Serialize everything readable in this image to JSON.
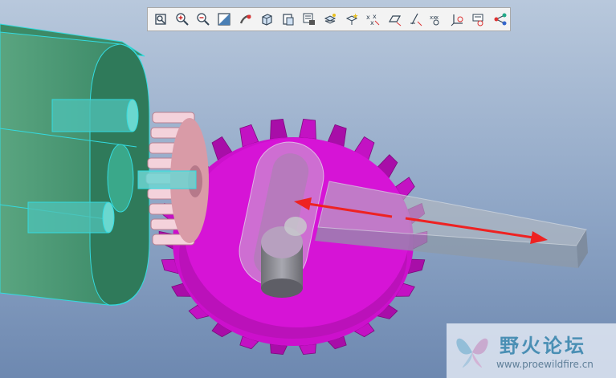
{
  "toolbar": {
    "items": [
      {
        "name": "refit-icon",
        "title": "Refit"
      },
      {
        "name": "zoom-in-icon",
        "title": "Zoom In"
      },
      {
        "name": "zoom-out-icon",
        "title": "Zoom Out"
      },
      {
        "name": "repaint-icon",
        "title": "Repaint"
      },
      {
        "name": "spin-center-icon",
        "title": "Spin Center"
      },
      {
        "name": "display-style-icon",
        "title": "Display Style"
      },
      {
        "name": "saved-views-icon",
        "title": "Saved Orientations"
      },
      {
        "name": "view-manager-icon",
        "title": "View Manager"
      },
      {
        "name": "layers-icon",
        "title": "Layers"
      },
      {
        "name": "appearance-icon",
        "title": "Appearance"
      },
      {
        "name": "datum-points-icon",
        "title": "Datum Points"
      },
      {
        "name": "datum-planes-icon",
        "title": "Datum Planes"
      },
      {
        "name": "datum-axes-icon",
        "title": "Datum Axes"
      },
      {
        "name": "point-display-icon",
        "title": "Point Display"
      },
      {
        "name": "csys-display-icon",
        "title": "Csys Display"
      },
      {
        "name": "annotation-display-icon",
        "title": "Annotation Display"
      },
      {
        "name": "connections-icon",
        "title": "Connections"
      }
    ]
  },
  "colors": {
    "background_top": "#b8c8dc",
    "background_bottom": "#6d88b0",
    "housing": "#3f8f70",
    "housing_edge": "#33dbe0",
    "large_gear": "#cc10cc",
    "small_gear": "#f2ccd6",
    "rack_arm": "#a7acb4",
    "arrow": "#ee2222",
    "toolbar_bg": "#f3f3f3"
  },
  "watermark": {
    "title": "野火论坛",
    "url": "www.proewildfire.cn"
  }
}
